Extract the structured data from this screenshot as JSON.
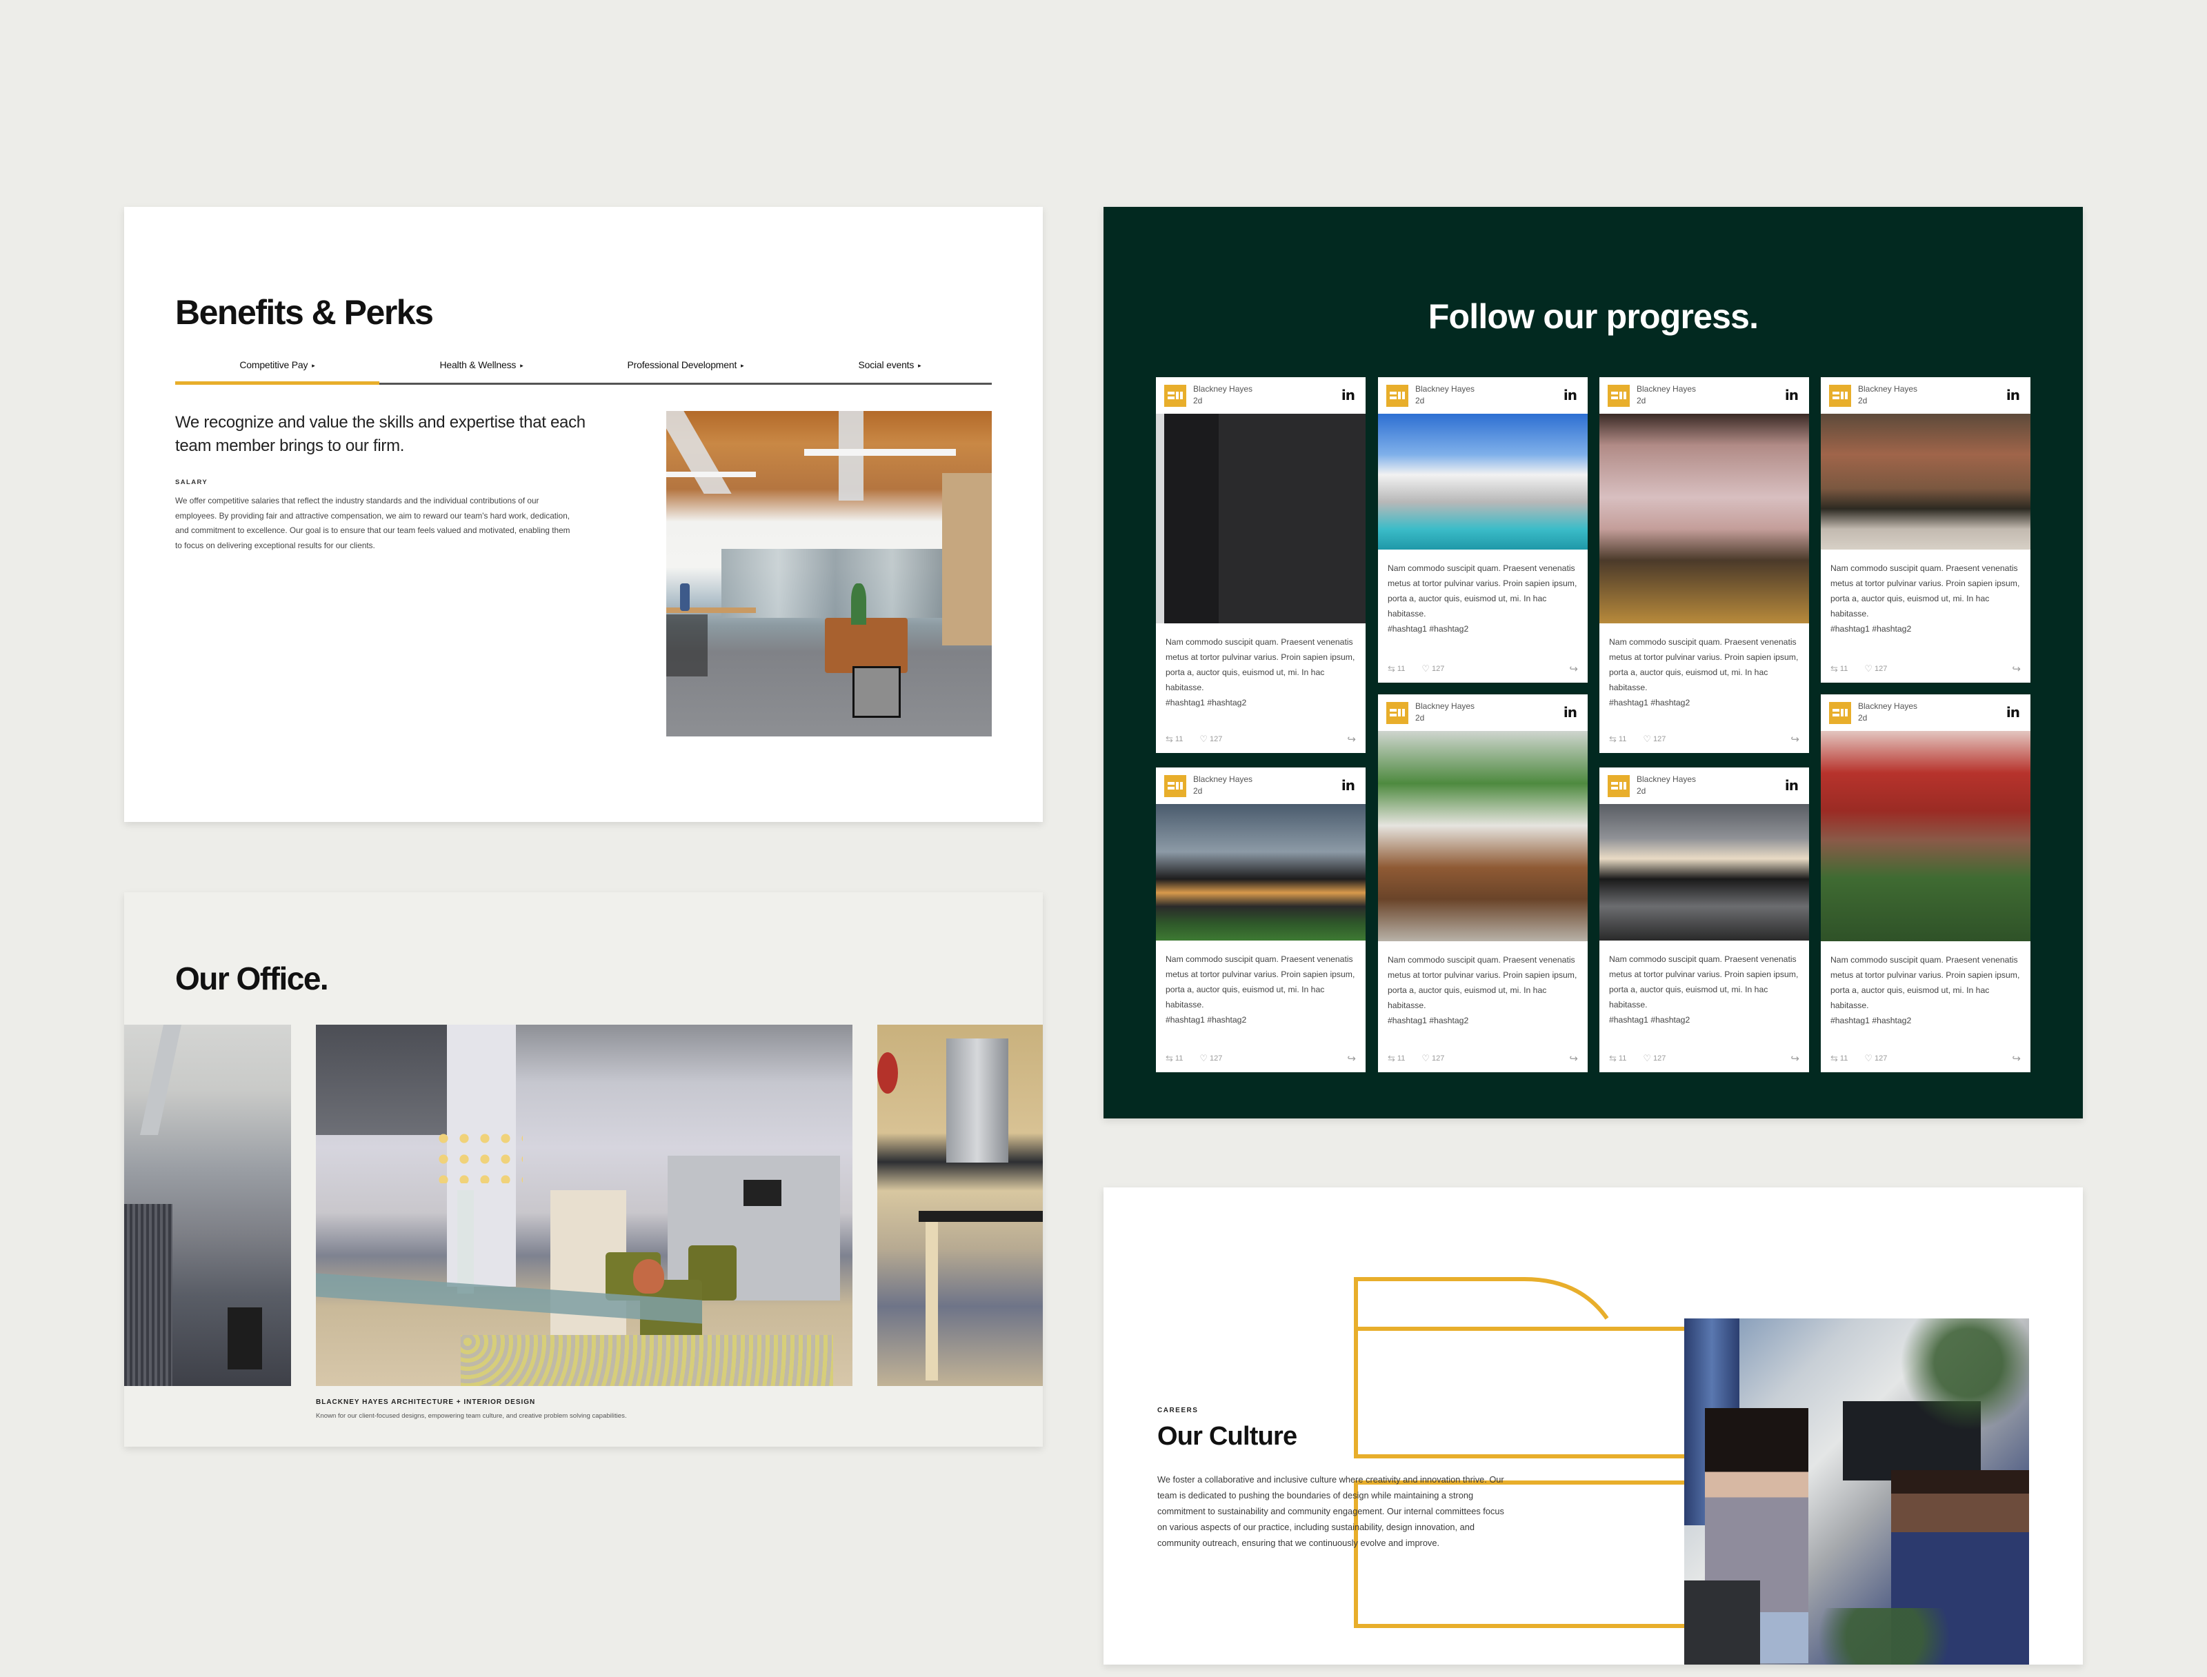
{
  "colors": {
    "page_background": "#edede9",
    "accent_yellow": "#e8ae2b",
    "dark_green": "#022920"
  },
  "benefits": {
    "title": "Benefits & Perks",
    "tabs": [
      {
        "label": "Competitive Pay",
        "active": true
      },
      {
        "label": "Health & Wellness",
        "active": false
      },
      {
        "label": "Professional Development",
        "active": false
      },
      {
        "label": "Social events",
        "active": false
      }
    ],
    "tab_caret": "▸",
    "lead": "We recognize and value the skills and expertise that each team member brings to our firm.",
    "section_label": "SALARY",
    "section_body": "We offer competitive salaries that reflect the industry standards and the individual contributions of our employees. By providing fair and attractive compensation, we aim to reward our team's hard work, dedication, and commitment to excellence. Our goal is to ensure that our team feels valued and motivated, enabling them to focus on delivering exceptional results for our clients.",
    "photo_alt": "Open-plan office with exposed wood ceiling, standing desks and leather sofa"
  },
  "office": {
    "title": "Our Office.",
    "images": [
      {
        "alt": "Workspace with cubicles and material samples"
      },
      {
        "alt": "Reception lounge with flowers, glass table and conference room"
      },
      {
        "alt": "Kitchen area with wooden island and flowers"
      }
    ],
    "caption_title": "BLACKNEY HAYES ARCHITECTURE + INTERIOR DESIGN",
    "caption_body": "Known for our client-focused designs, empowering team culture, and creative problem solving capabilities."
  },
  "social": {
    "title": "Follow our progress.",
    "author": "Blackney Hayes",
    "age": "2d",
    "network_icon": "in",
    "post_text": "Nam commodo suscipit quam. Praesent venenatis metus at tortor pulvinar varius. Proin sapien ipsum, porta a, auctor quis, euismod ut, mi. In hac habitasse.",
    "hashtags": "#hashtag1 #hashtag2",
    "reposts": "11",
    "likes": "127",
    "posts": [
      {
        "image": "woman-reading-magazine",
        "alt": "Woman in white shirt reading a magazine"
      },
      {
        "image": "modern-house-pool",
        "alt": "Modern white house with pool"
      },
      {
        "image": "velvet-bar-stools",
        "alt": "Pink velvet bar stools with gold legs"
      },
      {
        "image": "brick-cafe-interior",
        "alt": "Brick wall café with high tables"
      },
      {
        "image": "modern-house-night",
        "alt": "Modern house at dusk with lawn"
      },
      {
        "image": "palm-wooden-chair",
        "alt": "Wooden folding chairs under palm fronds"
      },
      {
        "image": "pool-reflection",
        "alt": "Modern building reflected in pool"
      },
      {
        "image": "brick-ruin-red-roof",
        "alt": "Brick ruin with red-roof house and ivy"
      }
    ]
  },
  "culture": {
    "eyebrow": "CAREERS",
    "title": "Our Culture",
    "body": "We foster a collaborative and inclusive culture where creativity and innovation thrive. Our team is dedicated to pushing the boundaries of design while maintaining a strong commitment to sustainability and community engagement. Our internal committees focus on various aspects of our practice, including sustainability, design innovation, and community outreach, ensuring that we continuously evolve and improve.",
    "photo_alt": "Two colleagues talking at their desks in an office"
  }
}
